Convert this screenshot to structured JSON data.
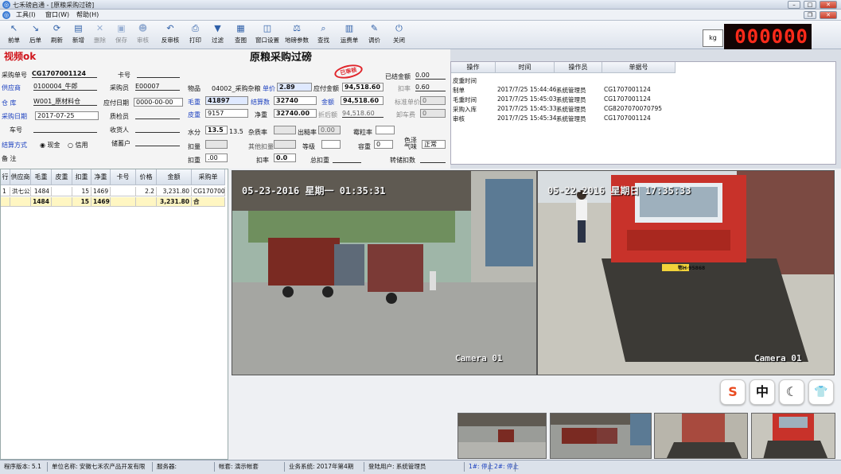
{
  "app": {
    "title": "七禾磅启通 - [原粮采购过磅]"
  },
  "menu": [
    "工具(I)",
    "窗口(W)",
    "帮助(H)"
  ],
  "toolbar": [
    {
      "label": "前单",
      "icon": "↖",
      "disabled": false
    },
    {
      "label": "后单",
      "icon": "↘",
      "disabled": false
    },
    {
      "label": "刷新",
      "icon": "⟳",
      "disabled": false
    },
    {
      "label": "新增",
      "icon": "▤",
      "disabled": false
    },
    {
      "label": "删除",
      "icon": "✕",
      "disabled": true
    },
    {
      "label": "保存",
      "icon": "▣",
      "disabled": true
    },
    {
      "label": "审核",
      "icon": "☻",
      "disabled": true
    },
    {
      "label": "反审核",
      "icon": "↶",
      "disabled": false
    },
    {
      "label": "打印",
      "icon": "⎙",
      "disabled": false
    },
    {
      "label": "过滤",
      "icon": "▼",
      "disabled": false
    },
    {
      "label": "查图",
      "icon": "▦",
      "disabled": false
    },
    {
      "label": "窗口设置",
      "icon": "◫",
      "disabled": false
    },
    {
      "label": "地磅参数",
      "icon": "⚖",
      "disabled": false
    },
    {
      "label": "查找",
      "icon": "⌕",
      "disabled": false
    },
    {
      "label": "运费单",
      "icon": "▥",
      "disabled": false
    },
    {
      "label": "调价",
      "icon": "✎",
      "disabled": false
    },
    {
      "label": "关闭",
      "icon": "⏻",
      "disabled": false
    }
  ],
  "display": {
    "unit": "kg",
    "weight": "000000"
  },
  "form": {
    "brand": "视频ok",
    "title": "原粮采购过磅",
    "stamp": "已审核",
    "order_no_label": "采购单号",
    "order_no": "CG1707001124",
    "card_no_label": "卡号",
    "supplier_label": "供应商",
    "supplier": "0100004_牛郎",
    "buyer_label": "采购员",
    "buyer": "E00007",
    "warehouse_label": "仓 库",
    "warehouse": "W001_原材料仓",
    "pay_date_label": "应付日期",
    "pay_date": "0000-00-00",
    "purchase_date_label": "采购日期",
    "purchase_date": "2017-07-25",
    "inspector_label": "质检员",
    "car_no_label": "车号",
    "receiver_label": "收货人",
    "settle_method_label": "结算方式",
    "settle_cash": "现金",
    "settle_credit": "信用",
    "remark_label": "备 注",
    "bank_label": "储蓄户",
    "goods_label": "物品",
    "goods": "04002_采购杂粮",
    "price_label": "单价",
    "price": "2.89",
    "payable_label": "应付金额",
    "payable": "94,518.60",
    "paid_label": "已结金额",
    "paid": "0.00",
    "gross_label": "毛重",
    "gross": "41897",
    "settle_wt_label": "结算数",
    "settle_wt": "32740",
    "amount_label": "金额",
    "amount": "94,518.60",
    "deduct_label": "扣率",
    "deduct": "0.60",
    "tare_label": "皮重",
    "tare": "9157",
    "net_label": "净重",
    "net": "32740.00",
    "discount_label": "折后额",
    "discount": "94,518.60",
    "unitprice2_label": "标准单价",
    "unitprice2": "0",
    "freight_label": "卸车费",
    "freight": "0",
    "moisture_label": "水分",
    "moisture": "13.5",
    "moisture2": "13.5",
    "impurity_label": "杂质率",
    "rate_label": "出糙率",
    "rate": "0.00",
    "plump_label": "霉粒率",
    "deductwt_label": "扣量",
    "otherdeduct_label": "其他扣量",
    "grade_label": "等级",
    "capacity_label": "容重",
    "capacity": "0",
    "color_label": "色泽气味",
    "color": "正常",
    "deduct2_label": "扣重",
    "deduct2": ".00",
    "deduct3_label": "扣率",
    "deduct3": "0.0",
    "total_deduct_label": "总扣重",
    "convert_label": "转储扣数"
  },
  "log": {
    "headers": [
      "操作",
      "时间",
      "操作员",
      "单据号"
    ],
    "rows": [
      [
        "皮重时间",
        "",
        "",
        ""
      ],
      [
        "制单",
        "2017/7/25 15:44:46",
        "系统管理员",
        "CG1707001124"
      ],
      [
        "毛重时间",
        "2017/7/25 15:45:03",
        "系统管理员",
        "CG1707001124"
      ],
      [
        "采购入库",
        "2017/7/25 15:45:33",
        "系统管理员",
        "CG8207070070795"
      ],
      [
        "审核",
        "2017/7/25 15:45:34",
        "系统管理员",
        "CG1707001124"
      ]
    ]
  },
  "grid": {
    "headers": [
      "行",
      "供应商",
      "毛重",
      "皮重",
      "扣重",
      "净重",
      "卡号",
      "价格",
      "金额",
      "采购单"
    ],
    "rows": [
      [
        "1",
        "洪七公",
        "1484",
        "",
        "15",
        "1469",
        "",
        "2.2",
        "3,231.80",
        "CG1707001"
      ]
    ],
    "total": [
      "",
      "",
      "1484",
      "",
      "15",
      "1469",
      "",
      "",
      "3,231.80",
      "合"
    ]
  },
  "cameras": [
    {
      "timestamp": "05-23-2016 星期一 01:35:31",
      "label": "Camera 01"
    },
    {
      "timestamp": "05-22-2016 星期日 17:35:33",
      "label": "Camera 01"
    }
  ],
  "plate": "鄂H·95868",
  "ime": [
    {
      "name": "sogou-icon",
      "glyph": "S"
    },
    {
      "name": "chinese-mode",
      "glyph": "中"
    },
    {
      "name": "moon-icon",
      "glyph": "☾"
    },
    {
      "name": "shirt-icon",
      "glyph": "👕"
    }
  ],
  "status": {
    "version": "程序版本: 5.1",
    "unit": "单位名称: 安徽七禾农产品开发有限",
    "server": "服务器:",
    "account": "帐套: 演示帐套",
    "period": "业务系统: 2017年第4期",
    "user": "登陆用户: 系统管理员",
    "scale1": "1#: 停止",
    "scale2": "2#: 停止"
  },
  "colors": {
    "brand": "#d0151b",
    "led": "#ff2a1a",
    "accent": "#1a3fbf"
  }
}
